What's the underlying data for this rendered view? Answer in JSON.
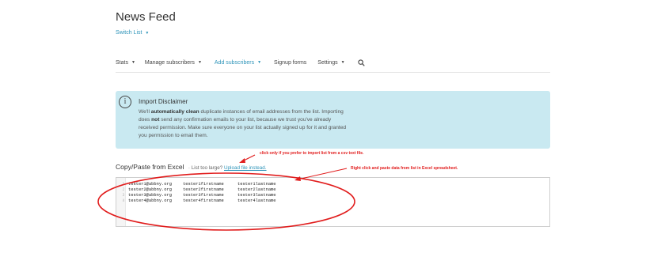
{
  "header": {
    "title": "News Feed",
    "switch_label": "Switch List",
    "switch_icon": "chevron-down-icon"
  },
  "nav": {
    "items": [
      {
        "label": "Stats",
        "active": false
      },
      {
        "label": "Manage subscribers",
        "active": false
      },
      {
        "label": "Add subscribers",
        "active": true
      },
      {
        "label": "Signup forms",
        "active": false
      },
      {
        "label": "Settings",
        "active": false
      }
    ],
    "search_icon": "search-icon"
  },
  "disclaimer": {
    "icon": "info-icon",
    "title": "Import Disclaimer",
    "line1_pre": "We'll ",
    "line1_bold": "automatically clean",
    "line1_post": " duplicate instances of email addresses from the list. Importing",
    "line2_pre": "does ",
    "line2_bold": "not",
    "line2_post": " send any confirmation emails to your list, because we trust you've already",
    "line3": "received permission. Make sure everyone on your list actually signed up for it and granted",
    "line4": "you permission to email them."
  },
  "copy_paste": {
    "title": "Copy/Paste from Excel",
    "separator": "·",
    "sub_text": "List too large?",
    "link_text": "Upload file instead."
  },
  "editor": {
    "rows": [
      {
        "num": "1",
        "email": "tester1@abbny.org",
        "first": "tester1firstname",
        "last": "tester1lastname"
      },
      {
        "num": "2",
        "email": "tester2@abbny.org",
        "first": "tester2firstname",
        "last": "tester2lastname"
      },
      {
        "num": "3",
        "email": "tester3@abbny.org",
        "first": "tester3firstname",
        "last": "tester3lastname"
      },
      {
        "num": "4",
        "email": "tester4@abbny.org",
        "first": "tester4firstname",
        "last": "tester4lastname"
      }
    ]
  },
  "annotations": {
    "upload_note": "click only if you prefer to import list from a csv text file.",
    "paste_note": "Right click and paste data from list in Excel spreadsheet.",
    "color": "#e11d1d"
  },
  "colors": {
    "accent": "#2e94b9",
    "disclaimer_bg": "#c9e9f1"
  }
}
